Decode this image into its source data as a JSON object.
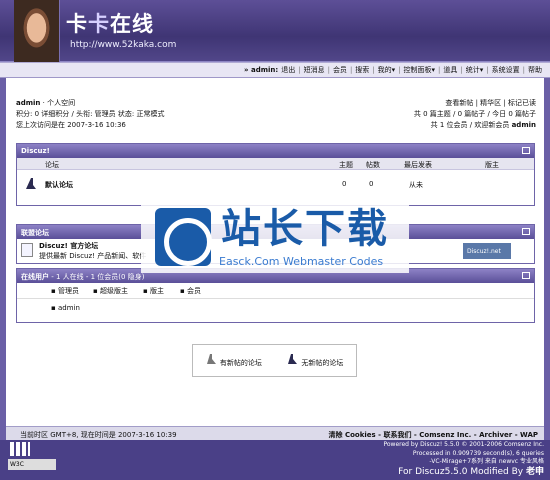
{
  "header": {
    "title_part1": "卡",
    "title_part2": "卡",
    "title_part3": "在线",
    "url": "http://www.52kaka.com"
  },
  "nav": {
    "user_prefix": "» admin:",
    "items": [
      "退出",
      "短消息",
      "会员",
      "搜索",
      "我的▾",
      "控制面板▾",
      "道具",
      "统计▾",
      "系统设置",
      "帮助"
    ]
  },
  "info_left": {
    "line1_user": "admin",
    "line1_rest": " · 个人空间",
    "line2": "积分: 0 详细积分 / 头衔: 管理员 状态: 正常模式",
    "line3": "您上次访问是在 2007-3-16 10:36"
  },
  "info_right": {
    "line1": "查看新帖 | 精华区 | 标记已读",
    "line2": "共 0 篇主题 / 0 篇帖子 / 今日 0 篇帖子",
    "line3": "共 1 位会员 / 欢迎新会员",
    "newest_member": "admin"
  },
  "forum_box": {
    "title": "Discuz!",
    "col_forum": "论坛",
    "col_topics": "主题",
    "col_posts": "帖数",
    "col_last": "最后发表",
    "col_moderator": "版主",
    "row_name": "默认论坛",
    "row_topics": "0",
    "row_posts": "0",
    "row_last": "从未"
  },
  "league_box": {
    "title": "联盟论坛",
    "link_title": "Discuz! 官方论坛",
    "link_desc": "提供最新 Discuz! 产品新闻、软件",
    "badge": "Discuz!.net"
  },
  "online_box": {
    "title_prefix": "在线用户",
    "title_rest": " - 1 人在线 - 1 位会员(0 隐身)",
    "roles": [
      "管理员",
      "超级版主",
      "版主",
      "会员"
    ],
    "user": "admin"
  },
  "watermark": {
    "cn": "站长下载",
    "en": "Easck.Com Webmaster Codes"
  },
  "legend": {
    "new": "有新帖的论坛",
    "none": "无新帖的论坛"
  },
  "footer": {
    "left": "当前时区 GMT+8, 现在时间是 2007-3-16 10:39",
    "right": "清除 Cookies - 联系我们 - Comsenz Inc. - Archiver - WAP"
  },
  "footer2": {
    "line1": "Powered by Discuz! 5.5.0 © 2001-2006 Comsenz Inc.",
    "line2": "Processed in 0.909739 second(s), 6 queries",
    "line3": "-VC-Mirage+7系列 来自 newvc 专业风格",
    "line4": "For Discuz5.5.0 Modified By ",
    "line4b": "老申",
    "icon_label": "W3C"
  }
}
